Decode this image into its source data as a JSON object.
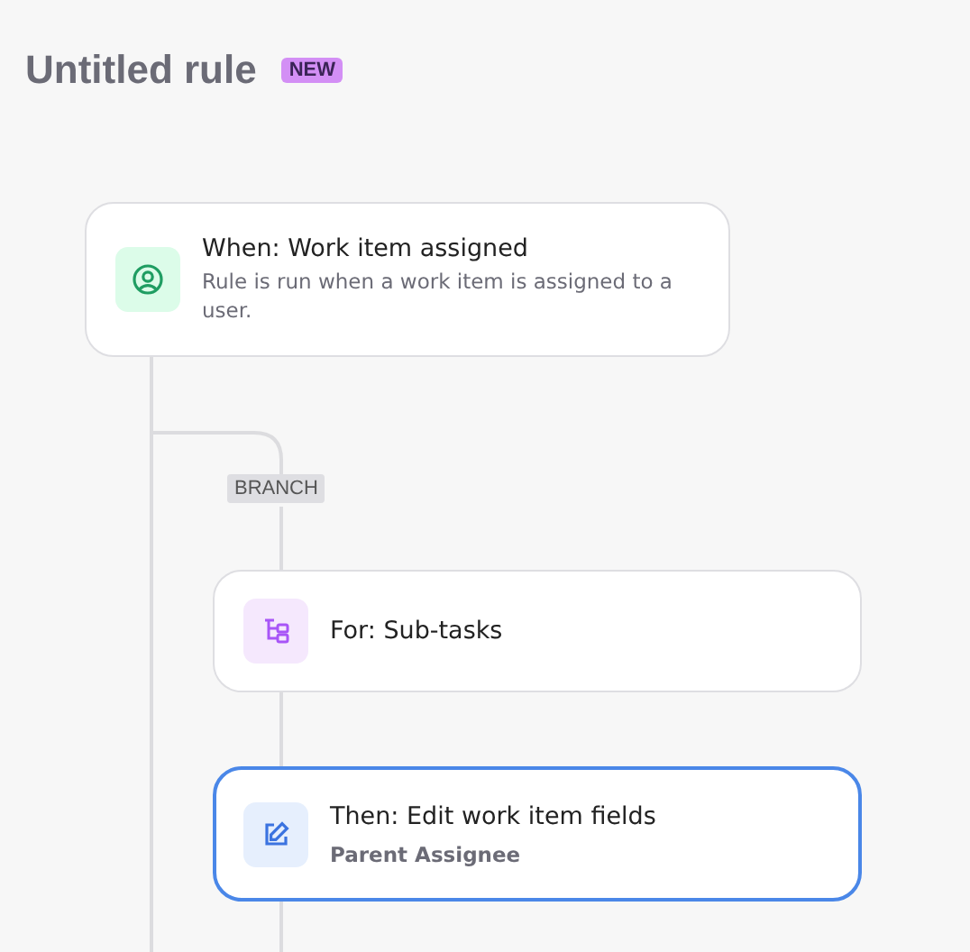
{
  "title": "Untitled rule",
  "badge": "NEW",
  "trigger": {
    "kind": "trigger",
    "title": "When: Work item assigned",
    "description": "Rule is run when a work item is assigned to a user.",
    "selected": false
  },
  "branch": {
    "label": "BRANCH",
    "steps": [
      {
        "kind": "for",
        "title": "For: Sub-tasks",
        "selected": false
      },
      {
        "kind": "action",
        "title": "Then: Edit work item fields",
        "subtitle": "Parent Assignee",
        "selected": true
      }
    ]
  }
}
